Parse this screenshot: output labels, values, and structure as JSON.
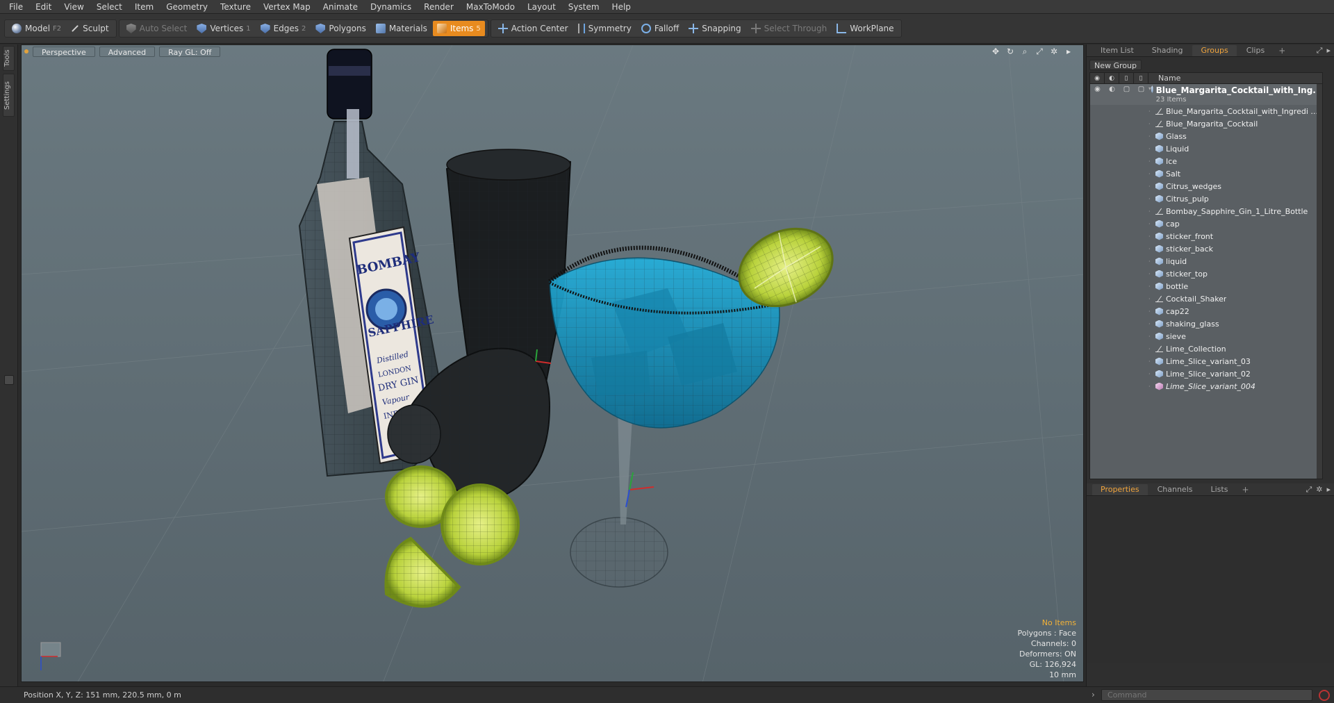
{
  "menu": [
    "File",
    "Edit",
    "View",
    "Select",
    "Item",
    "Geometry",
    "Texture",
    "Vertex Map",
    "Animate",
    "Dynamics",
    "Render",
    "MaxToModo",
    "Layout",
    "System",
    "Help"
  ],
  "toolbar": {
    "model": {
      "label": "Model",
      "key": "F2"
    },
    "sculpt": {
      "label": "Sculpt"
    },
    "auto_select": {
      "label": "Auto Select"
    },
    "vertices": {
      "label": "Vertices",
      "key": "1"
    },
    "edges": {
      "label": "Edges",
      "key": "2"
    },
    "polygons": {
      "label": "Polygons"
    },
    "materials": {
      "label": "Materials"
    },
    "items": {
      "label": "Items",
      "key": "5"
    },
    "action_center": {
      "label": "Action Center"
    },
    "symmetry": {
      "label": "Symmetry"
    },
    "falloff": {
      "label": "Falloff"
    },
    "snapping": {
      "label": "Snapping"
    },
    "select_through": {
      "label": "Select Through"
    },
    "workplane": {
      "label": "WorkPlane"
    }
  },
  "left_tabs": {
    "tools": "Tools",
    "settings": "Settings"
  },
  "viewport": {
    "view_mode": "Perspective",
    "shading": "Advanced",
    "raygl": "Ray GL: Off",
    "stats": {
      "selection": "No Items",
      "polygons": "Polygons : Face",
      "channels": "Channels: 0",
      "deformers": "Deformers: ON",
      "gl": "GL: 126,924",
      "grid": "10 mm"
    },
    "label_art": {
      "brand_1": "BOMBAY",
      "brand_2": "SAPPHIRE",
      "line_1": "Distilled",
      "line_2": "LONDON",
      "line_3": "DRY GIN",
      "line_4": "Vapour",
      "line_5": "INFUSED"
    }
  },
  "right_panel": {
    "tabs": [
      "Item List",
      "Shading",
      "Groups",
      "Clips"
    ],
    "active_tab": "Groups",
    "new_group": "New Group",
    "name_header": "Name",
    "group": {
      "name": "Blue_Margarita_Cocktail_with_Ing...",
      "count": "23 Items"
    },
    "items": [
      {
        "label": "Blue_Margarita_Cocktail_with_Ingredi ...",
        "icon": "locator-icon"
      },
      {
        "label": "Blue_Margarita_Cocktail",
        "icon": "locator-icon"
      },
      {
        "label": "Glass",
        "icon": "mesh-icon"
      },
      {
        "label": "Liquid",
        "icon": "mesh-icon"
      },
      {
        "label": "Ice",
        "icon": "mesh-icon"
      },
      {
        "label": "Salt",
        "icon": "mesh-icon"
      },
      {
        "label": "Citrus_wedges",
        "icon": "mesh-icon"
      },
      {
        "label": "Citrus_pulp",
        "icon": "mesh-icon"
      },
      {
        "label": "Bombay_Sapphire_Gin_1_Litre_Bottle",
        "icon": "locator-icon"
      },
      {
        "label": "cap",
        "icon": "mesh-icon"
      },
      {
        "label": "sticker_front",
        "icon": "mesh-icon"
      },
      {
        "label": "sticker_back",
        "icon": "mesh-icon"
      },
      {
        "label": "liquid",
        "icon": "mesh-icon"
      },
      {
        "label": "sticker_top",
        "icon": "mesh-icon"
      },
      {
        "label": "bottle",
        "icon": "mesh-icon"
      },
      {
        "label": "Cocktail_Shaker",
        "icon": "locator-icon"
      },
      {
        "label": "cap22",
        "icon": "mesh-icon"
      },
      {
        "label": "shaking_glass",
        "icon": "mesh-icon"
      },
      {
        "label": "sieve",
        "icon": "mesh-icon"
      },
      {
        "label": "Lime_Collection",
        "icon": "locator-icon"
      },
      {
        "label": "Lime_Slice_variant_03",
        "icon": "mesh-icon"
      },
      {
        "label": "Lime_Slice_variant_02",
        "icon": "mesh-icon"
      },
      {
        "label": "Lime_Slice_variant_004",
        "icon": "mesh-icon-pink",
        "italic": true
      }
    ],
    "props_tabs": [
      "Properties",
      "Channels",
      "Lists"
    ],
    "props_active": "Properties"
  },
  "status": {
    "position": "Position X, Y, Z:   151 mm, 220.5 mm, 0 m"
  },
  "command": {
    "placeholder": "Command"
  },
  "colors": {
    "accent": "#e88b1f",
    "viewport_bg": "#5f6d74",
    "liquid": "#1a98c4",
    "lime": "#b7d23a"
  }
}
